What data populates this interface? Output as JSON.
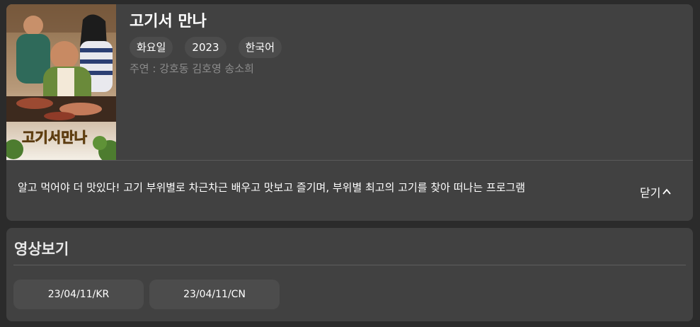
{
  "show": {
    "title": "고기서 만나",
    "tags": [
      "화요일",
      "2023",
      "한국어"
    ],
    "cast": "주연 : 강호동 김호영 송소희",
    "description": "알고 먹어야 더 맛있다! 고기 부위별로 차근차근 배우고 맛보고 즐기며, 부위별 최고의 고기를 찾아 떠나는 프로그램",
    "close_label": "닫기",
    "poster": {
      "logo_text": "고기서만나",
      "logo_color": "#f2b300"
    }
  },
  "videos": {
    "section_title": "영상보기",
    "episodes": [
      "23/04/11/KR",
      "23/04/11/CN"
    ]
  }
}
